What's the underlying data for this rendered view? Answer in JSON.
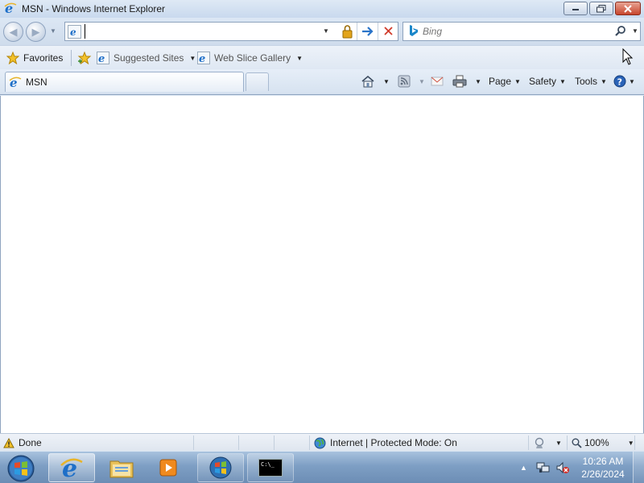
{
  "window": {
    "title": "MSN - Windows Internet Explorer"
  },
  "address": {
    "value": ""
  },
  "search": {
    "placeholder": "Bing"
  },
  "favorites_bar": {
    "favorites_label": "Favorites",
    "items": [
      {
        "label": "Suggested Sites"
      },
      {
        "label": "Web Slice Gallery"
      }
    ]
  },
  "tabs": [
    {
      "label": "MSN"
    }
  ],
  "command_bar": {
    "page_label": "Page",
    "safety_label": "Safety",
    "tools_label": "Tools"
  },
  "status_bar": {
    "status_text": "Done",
    "zone_text": "Internet | Protected Mode: On",
    "zoom_text": "100%"
  },
  "taskbar": {
    "time": "10:26 AM",
    "date": "2/26/2024",
    "cmd_label": "C:\\_"
  },
  "colors": {
    "ie_blue": "#1e6fc8",
    "taskbar": "#7e9fc4",
    "close_red": "#c7452d"
  }
}
